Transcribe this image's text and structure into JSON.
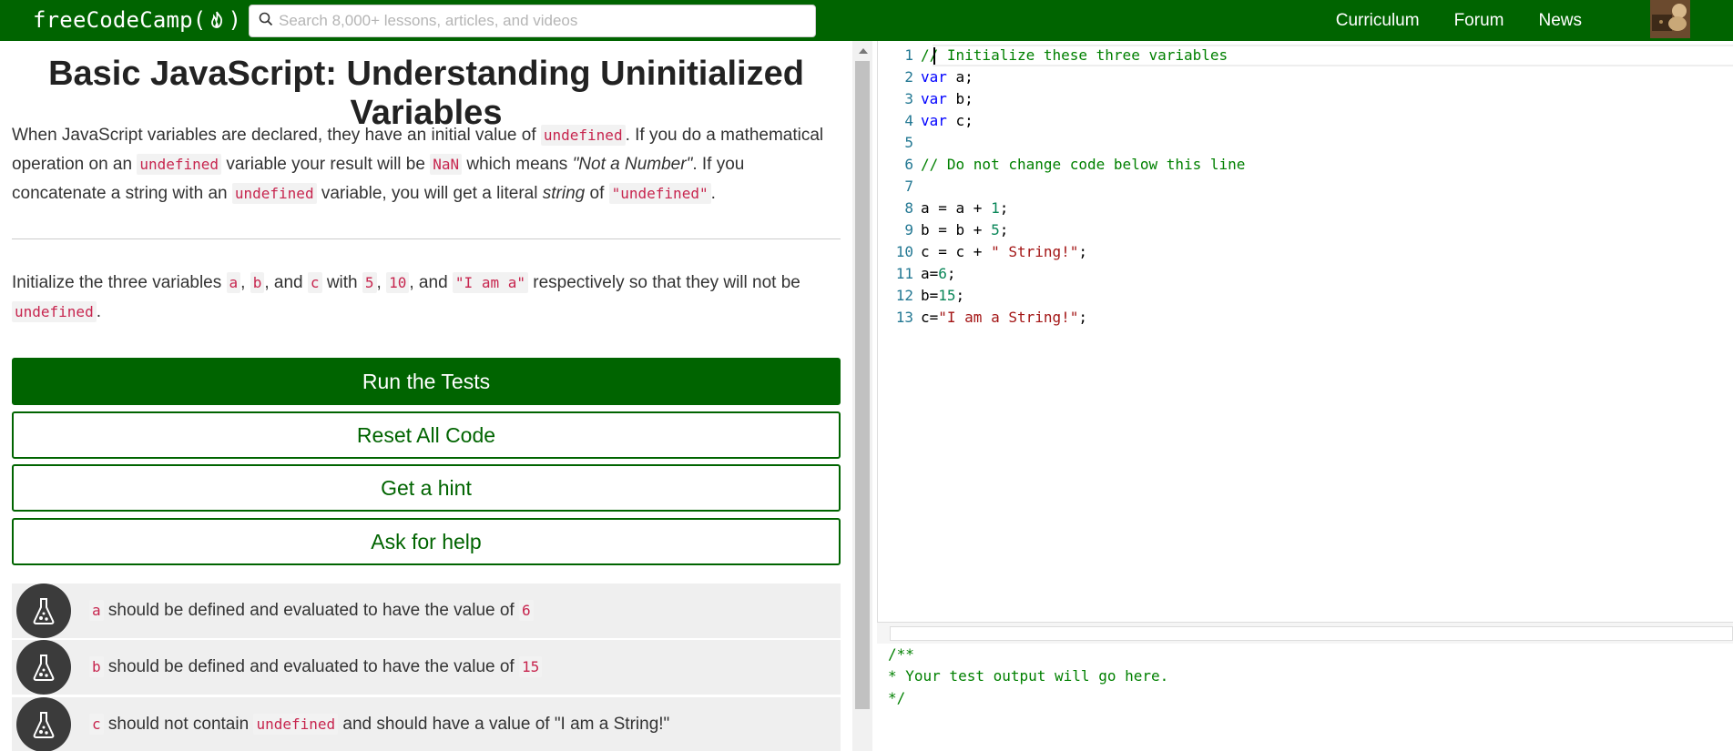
{
  "nav": {
    "logo_prefix": "freeCodeCamp(",
    "logo_suffix": ")",
    "search_placeholder": "Search 8,000+ lessons, articles, and videos",
    "links": [
      "Curriculum",
      "Forum",
      "News"
    ]
  },
  "lesson": {
    "title": "Basic JavaScript: Understanding Uninitialized Variables",
    "p1": {
      "t1": "When JavaScript variables are declared, they have an initial value of ",
      "c1": "undefined",
      "t2": ". If you do a mathematical operation on an ",
      "c2": "undefined",
      "t3": " variable your result will be ",
      "c3": "NaN",
      "t4": " which means ",
      "e1": "\"Not a Number\"",
      "t5": ". If you concatenate a string with an ",
      "c4": "undefined",
      "t6": " variable, you will get a literal ",
      "e2": "string",
      "t7": " of ",
      "c5": "\"undefined\"",
      "t8": "."
    },
    "p2": {
      "t1": "Initialize the three variables ",
      "c1": "a",
      "t2": ", ",
      "c2": "b",
      "t3": ", and ",
      "c3": "c",
      "t4": " with ",
      "c4": "5",
      "t5": ", ",
      "c5": "10",
      "t6": ", and ",
      "c6": "\"I am a\"",
      "t7": " respectively so that they will not be ",
      "c7": "undefined",
      "t8": "."
    }
  },
  "buttons": {
    "run": "Run the Tests",
    "reset": "Reset All Code",
    "hint": "Get a hint",
    "help": "Ask for help"
  },
  "tests": [
    {
      "code": "a",
      "text": " should be defined and evaluated to have the value of ",
      "code2": "6",
      "tail": ""
    },
    {
      "code": "b",
      "text": " should be defined and evaluated to have the value of ",
      "code2": "15",
      "tail": ""
    },
    {
      "code": "c",
      "text": " should not contain ",
      "code2": "undefined",
      "tail": " and should have a value of \"I am a String!\""
    }
  ],
  "editor": {
    "lines": [
      {
        "n": "1",
        "parts": [
          {
            "t": "// Initialize these three variables",
            "c": "tok-c"
          }
        ]
      },
      {
        "n": "2",
        "parts": [
          {
            "t": "var",
            "c": "tok-k"
          },
          {
            "t": " a;",
            "c": "ct"
          }
        ]
      },
      {
        "n": "3",
        "parts": [
          {
            "t": "var",
            "c": "tok-k"
          },
          {
            "t": " b;",
            "c": "ct"
          }
        ]
      },
      {
        "n": "4",
        "parts": [
          {
            "t": "var",
            "c": "tok-k"
          },
          {
            "t": " c;",
            "c": "ct"
          }
        ]
      },
      {
        "n": "5",
        "parts": []
      },
      {
        "n": "6",
        "parts": [
          {
            "t": "// Do not change code below this line",
            "c": "tok-c"
          }
        ]
      },
      {
        "n": "7",
        "parts": []
      },
      {
        "n": "8",
        "parts": [
          {
            "t": "a = a + ",
            "c": "ct"
          },
          {
            "t": "1",
            "c": "tok-n"
          },
          {
            "t": ";",
            "c": "ct"
          }
        ]
      },
      {
        "n": "9",
        "parts": [
          {
            "t": "b = b + ",
            "c": "ct"
          },
          {
            "t": "5",
            "c": "tok-n"
          },
          {
            "t": ";",
            "c": "ct"
          }
        ]
      },
      {
        "n": "10",
        "parts": [
          {
            "t": "c = c + ",
            "c": "ct"
          },
          {
            "t": "\" String!\"",
            "c": "tok-s"
          },
          {
            "t": ";",
            "c": "ct"
          }
        ]
      },
      {
        "n": "11",
        "parts": [
          {
            "t": "a=",
            "c": "ct"
          },
          {
            "t": "6",
            "c": "tok-n"
          },
          {
            "t": ";",
            "c": "ct"
          }
        ]
      },
      {
        "n": "12",
        "parts": [
          {
            "t": "b=",
            "c": "ct"
          },
          {
            "t": "15",
            "c": "tok-n"
          },
          {
            "t": ";",
            "c": "ct"
          }
        ]
      },
      {
        "n": "13",
        "parts": [
          {
            "t": "c=",
            "c": "ct"
          },
          {
            "t": "\"I am a String!\"",
            "c": "tok-s"
          },
          {
            "t": ";",
            "c": "ct"
          }
        ]
      }
    ]
  },
  "output": [
    "/**",
    "* Your test output will go here.",
    "*/"
  ]
}
